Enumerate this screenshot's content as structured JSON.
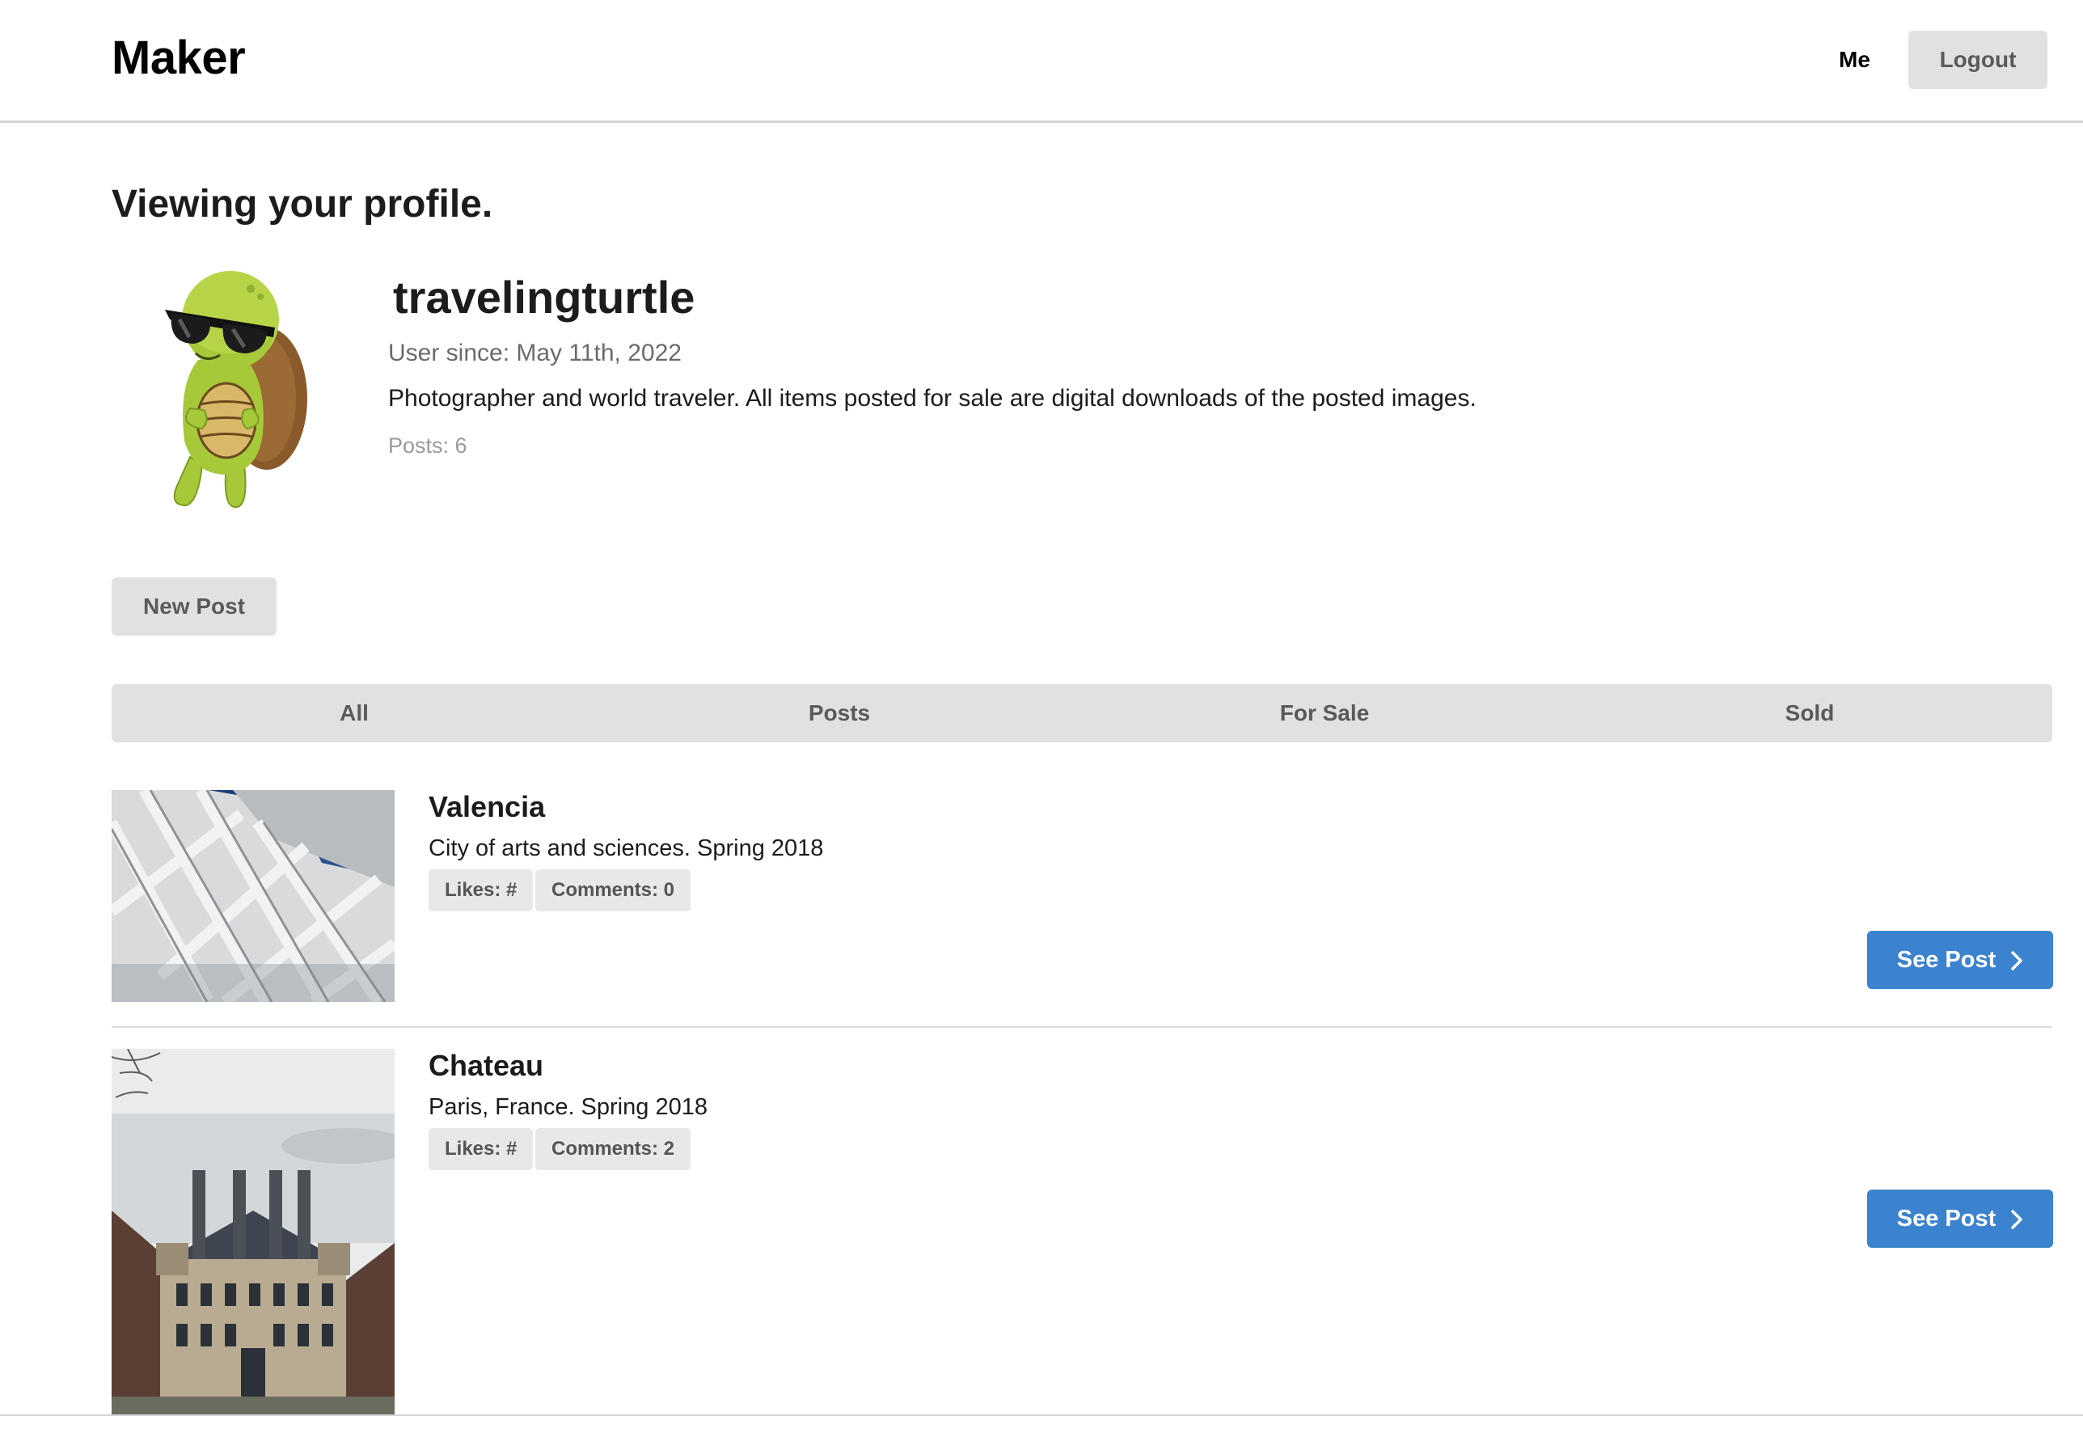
{
  "nav": {
    "brand": "Maker",
    "me_label": "Me",
    "logout_label": "Logout"
  },
  "profile": {
    "heading": "Viewing your profile.",
    "username": "travelingturtle",
    "user_since": "User since: May 11th, 2022",
    "bio": "Photographer and world traveler. All items posted for sale are digital downloads of the posted images.",
    "posts_count": "Posts: 6"
  },
  "actions": {
    "new_post_label": "New Post"
  },
  "tabs": [
    {
      "label": "All"
    },
    {
      "label": "Posts"
    },
    {
      "label": "For Sale"
    },
    {
      "label": "Sold"
    }
  ],
  "posts": [
    {
      "title": "Valencia",
      "description": "City of arts and sciences. Spring 2018",
      "likes": "Likes: #",
      "comments": "Comments: 0",
      "button_label": "See Post"
    },
    {
      "title": "Chateau",
      "description": "Paris, France. Spring 2018",
      "likes": "Likes: #",
      "comments": "Comments: 2",
      "button_label": "See Post"
    }
  ],
  "colors": {
    "primary_button": "#3b83cf",
    "grey_button": "#e0e1e2",
    "avatar_green": "#a6c93a",
    "avatar_shell": "#8a5a2b"
  }
}
